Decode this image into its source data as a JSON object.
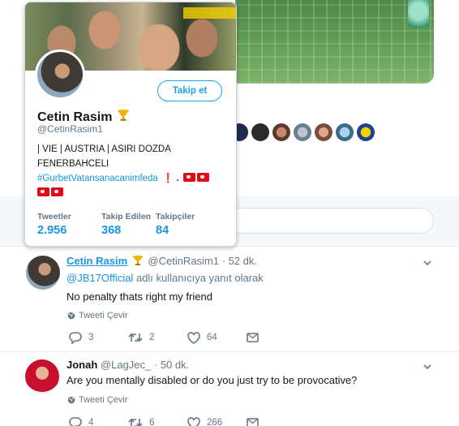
{
  "card": {
    "name": "Cetin Rasim",
    "handle": "@CetinRasim1",
    "follow_label": "Takip et",
    "bio_line1": "| VIE | AUSTRIA | ASIRI DOZDA",
    "bio_line2": "FENERBAHCELI",
    "bio_hashtag": "#GurbetVatansanacanimfeda",
    "bio_punct": "❗ .",
    "stats": [
      {
        "label": "Tweetler",
        "value": "2.956"
      },
      {
        "label": "Takip Edilen",
        "value": "368"
      },
      {
        "label": "Takipçiler",
        "value": "84"
      }
    ]
  },
  "tweets": [
    {
      "name": "Cetin Rasim",
      "handle": "@CetinRasim1",
      "time": "· 52 dk.",
      "reply_to_handle": "@JB17Official",
      "reply_to_suffix": " adlı kullanıcıya yanıt olarak",
      "text": "No penalty thats right my friend",
      "translate": "Tweeti Çevir",
      "replies": "3",
      "retweets": "2",
      "likes": "64"
    },
    {
      "name": "Jonah",
      "handle": "@LagJec_",
      "time": "· 50 dk.",
      "text": "Are you mentally disabled or do you just try to be provocative?",
      "translate": "Tweeti Çevir",
      "replies": "4",
      "retweets": "6",
      "likes": "266"
    }
  ],
  "colors": {
    "accent": "#1da1f2",
    "link": "#1b95e0",
    "muted": "#657786",
    "thread_line": "#c4e0f2"
  },
  "icons": [
    "trophy-icon",
    "reply-icon",
    "retweet-icon",
    "like-icon",
    "dm-icon",
    "globe-icon",
    "chevron-down-icon",
    "turkey-flag-icon"
  ]
}
